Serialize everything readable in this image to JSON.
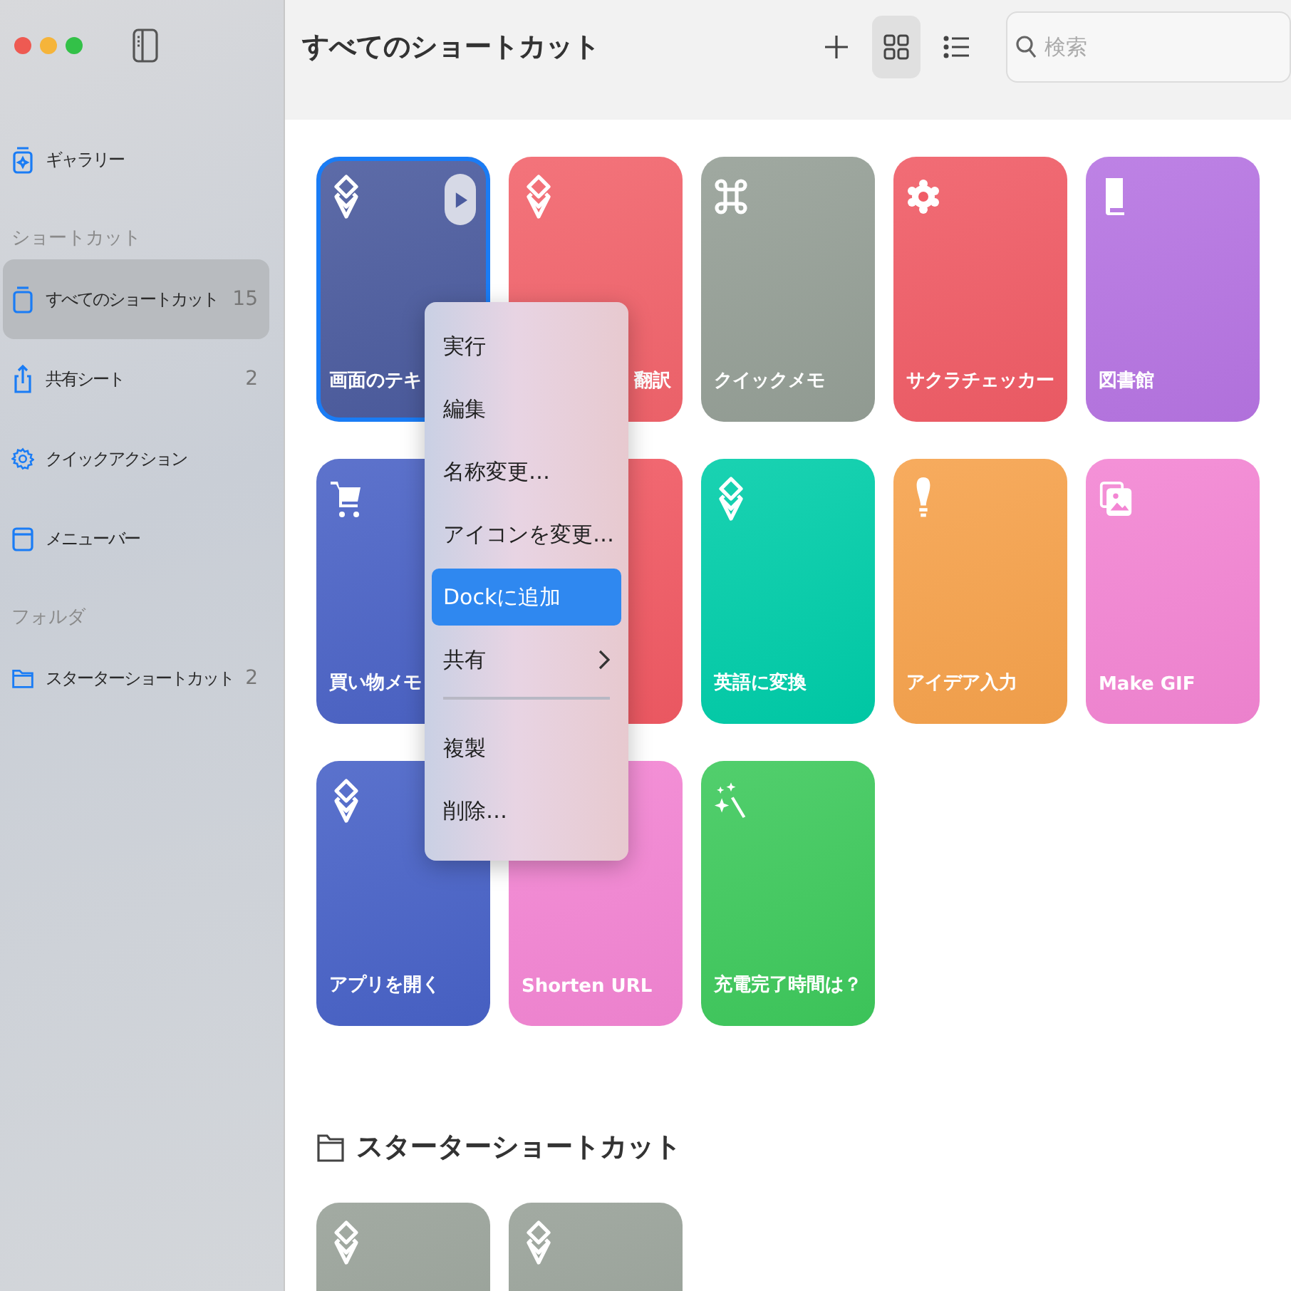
{
  "sidebar": {
    "items": [
      {
        "kind": "gallery",
        "label": "ギャラリー",
        "selected": false
      }
    ],
    "sections": [
      {
        "title": "ショートカット",
        "items": [
          {
            "kind": "stack",
            "label": "すべてのショートカット",
            "count": "15",
            "selected": true
          },
          {
            "kind": "share",
            "label": "共有シート",
            "count": "2",
            "selected": false
          },
          {
            "kind": "gear",
            "label": "クイックアクション",
            "selected": false
          },
          {
            "kind": "menubar",
            "label": "メニューバー",
            "selected": false
          }
        ]
      },
      {
        "title": "フォルダ",
        "items": [
          {
            "kind": "folder",
            "label": "スターターショートカット",
            "count": "2",
            "selected": false
          }
        ]
      }
    ]
  },
  "toolbar": {
    "title": "すべてのショートカット",
    "view_buttons": [
      {
        "kind": "grid",
        "selected": true
      },
      {
        "kind": "list",
        "selected": false
      }
    ],
    "search": {
      "placeholder": "検索"
    }
  },
  "cards": [
    {
      "label": "画面のテキ",
      "kind": "shortcuts",
      "color": "#4b5b9e",
      "selected": true
    },
    {
      "label": "翻訳",
      "kind": "shortcuts",
      "color": "#f2646c",
      "selected": false
    },
    {
      "label": "クイックメモ",
      "kind": "command",
      "color": "#959f96",
      "selected": false
    },
    {
      "label": "サクラチェッカー",
      "kind": "flower",
      "color": "#f05c66",
      "selected": false
    },
    {
      "label": "図書館",
      "kind": "book",
      "color": "#b674e2",
      "selected": false
    },
    {
      "label": "買い物メモ",
      "kind": "cart",
      "color": "#4b63c6",
      "selected": false
    },
    {
      "color": "#f15a64",
      "selected": false
    },
    {
      "label": "英語に変換",
      "kind": "shortcuts",
      "color": "#00cda9",
      "selected": false
    },
    {
      "label": "アイデア入力",
      "kind": "bulb",
      "color": "#f6a24c",
      "selected": false
    },
    {
      "label": "Make GIF",
      "kind": "photos",
      "color": "#f385d3",
      "selected": false
    },
    {
      "label": "アプリを開く",
      "kind": "shortcuts",
      "color": "#4862c7",
      "selected": false
    },
    {
      "label": "Shorten URL",
      "color": "#f385d3",
      "selected": false
    },
    {
      "label": "充電完了時間は？",
      "kind": "sparkles",
      "color": "#3ec95c",
      "selected": false
    }
  ],
  "folder_section": {
    "title": "スターターショートカット",
    "cards": [
      {
        "kind": "shortcuts",
        "color": "#98a198",
        "selected": false
      },
      {
        "kind": "shortcuts",
        "color": "#98a198",
        "selected": false
      }
    ]
  },
  "context_menu": {
    "items": [
      {
        "kind": "item",
        "label": "実行",
        "selected": false
      },
      {
        "kind": "item",
        "label": "編集",
        "selected": false
      },
      {
        "kind": "item",
        "label": "名称変更…",
        "selected": false
      },
      {
        "kind": "item",
        "label": "アイコンを変更…",
        "selected": false
      },
      {
        "kind": "item",
        "label": "Dockに追加",
        "selected": true
      },
      {
        "kind": "submenu",
        "label": "共有",
        "selected": false
      },
      {
        "kind": "separator"
      },
      {
        "kind": "item",
        "label": "複製",
        "selected": false
      },
      {
        "kind": "item",
        "label": "削除…",
        "selected": false
      }
    ]
  }
}
